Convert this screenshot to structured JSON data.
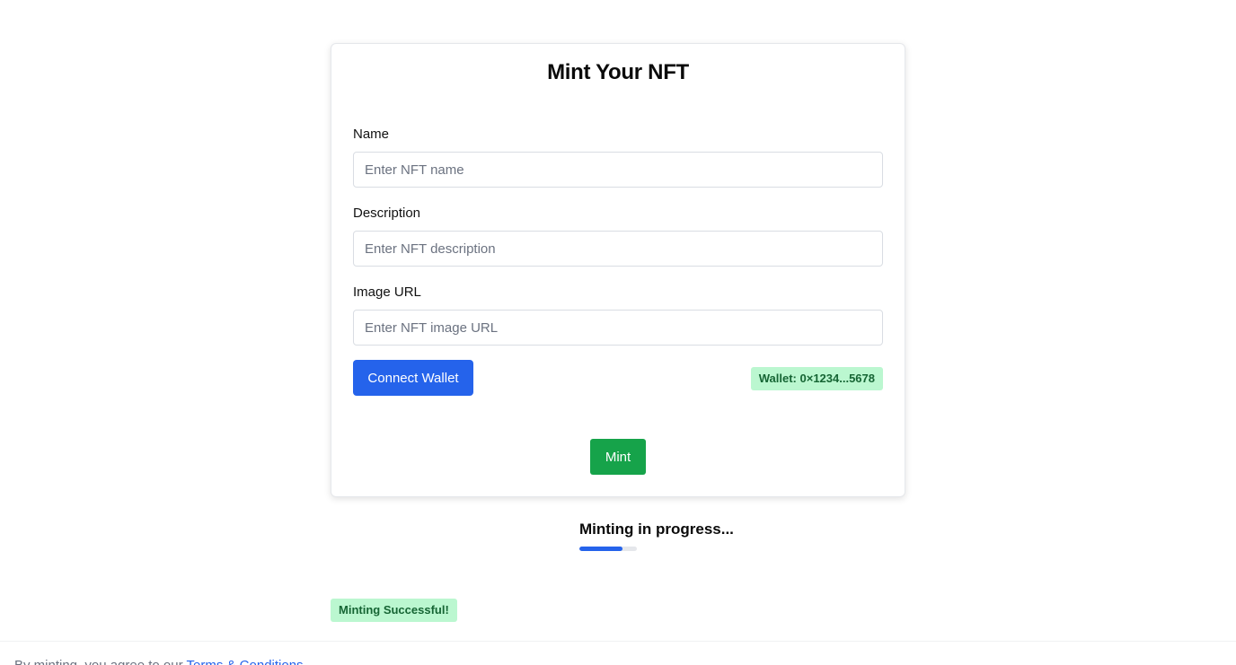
{
  "form": {
    "title": "Mint Your NFT",
    "fields": [
      {
        "label": "Name",
        "placeholder": "Enter NFT name",
        "value": ""
      },
      {
        "label": "Description",
        "placeholder": "Enter NFT description",
        "value": ""
      },
      {
        "label": "Image URL",
        "placeholder": "Enter NFT image URL",
        "value": ""
      }
    ],
    "connect_label": "Connect Wallet",
    "wallet_text": "Wallet: 0×1234...5678",
    "mint_label": "Mint"
  },
  "status": {
    "progress_text": "Minting in progress...",
    "progress_fraction": 0.75,
    "success_text": "Minting Successful!"
  },
  "footer": {
    "text": "By minting, you agree to our",
    "link_text": "Terms & Conditions"
  },
  "colors": {
    "primary": "#2563eb",
    "success": "#16a34a",
    "badge_bg": "#bbf7d0",
    "badge_text": "#166534"
  }
}
